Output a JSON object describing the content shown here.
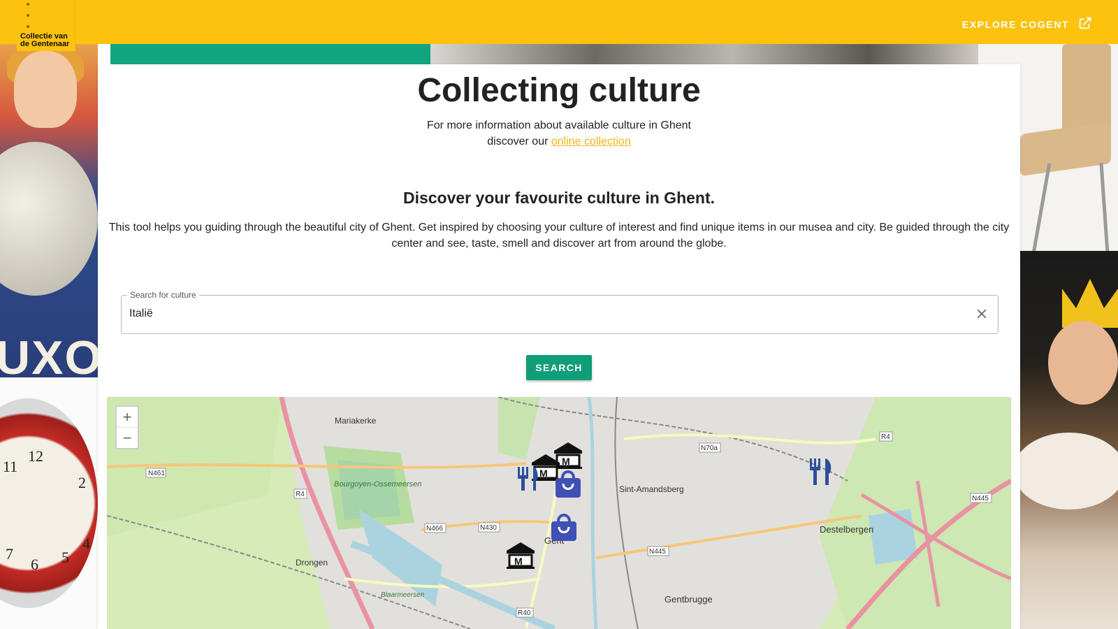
{
  "header": {
    "logo_line1": "Collectie van",
    "logo_line2": "de Gentenaar",
    "explore_label": "EXPLORE COGENT"
  },
  "main": {
    "title": "Collecting culture",
    "intro_line1": "For more information about available culture in Ghent",
    "intro_prefix": "discover our ",
    "intro_link": "online collection",
    "subtitle": "Discover your favourite culture in Ghent.",
    "description": "This tool helps you guiding through the beautiful city of Ghent. Get inspired by choosing your culture of interest and find unique items in our musea and city. Be guided through the city center and see, taste, smell and discover art from around the globe.",
    "search_legend": "Search for culture",
    "search_value": "Italië",
    "search_button": "SEARCH"
  },
  "background": {
    "poster_word": "UXO"
  },
  "map": {
    "zoom_in": "+",
    "zoom_out": "−",
    "places": [
      {
        "label": "Mariakerke"
      },
      {
        "label": "Bourgoyen-Ossemeersen"
      },
      {
        "label": "Sint-Amandsberg"
      },
      {
        "label": "Destelbergen"
      },
      {
        "label": "Drongen"
      },
      {
        "label": "Gent"
      },
      {
        "label": "Gentbrugge"
      },
      {
        "label": "Blaarmeersen"
      }
    ],
    "roads": [
      "N461",
      "R4",
      "N466",
      "N430",
      "N445",
      "N70a",
      "R40",
      "N445",
      "R4"
    ],
    "markers": [
      "museum-marker",
      "museum-marker",
      "museum-marker",
      "restaurant-marker",
      "restaurant-marker",
      "shop-marker",
      "shop-marker"
    ],
    "colors": {
      "water": "#aad3df",
      "park": "#cdebb0",
      "road_major": "#e892a2",
      "road_secondary": "#f7fabf",
      "urban": "#e0dfdf"
    }
  }
}
